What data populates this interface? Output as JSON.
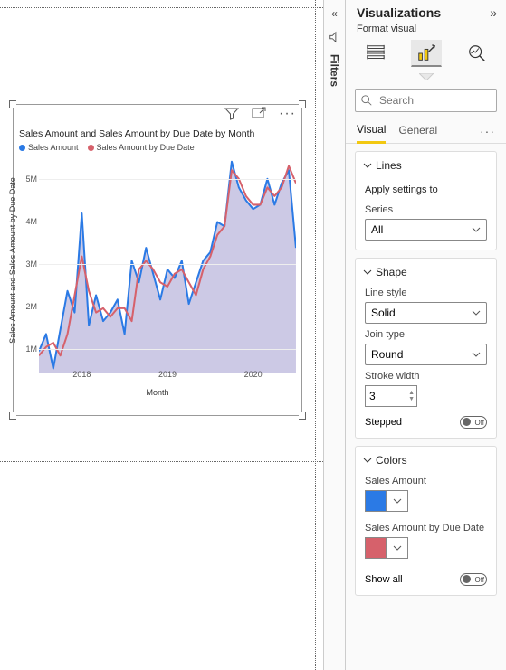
{
  "rail": {
    "filters_label": "Filters"
  },
  "pane": {
    "title": "Visualizations",
    "subtitle": "Format visual",
    "search_placeholder": "Search",
    "tabs": {
      "visual": "Visual",
      "general": "General"
    },
    "lines": {
      "header": "Lines",
      "apply": "Apply settings to",
      "series_label": "Series",
      "series_value": "All"
    },
    "shape": {
      "header": "Shape",
      "line_style_label": "Line style",
      "line_style_value": "Solid",
      "join_label": "Join type",
      "join_value": "Round",
      "stroke_label": "Stroke width",
      "stroke_value": "3",
      "stepped_label": "Stepped",
      "stepped_state": "Off"
    },
    "colors": {
      "header": "Colors",
      "series1_label": "Sales Amount",
      "series1_hex": "#2b7ae5",
      "series2_label": "Sales Amount by Due Date",
      "series2_hex": "#d6616b",
      "showall_label": "Show all",
      "showall_state": "Off"
    }
  },
  "chart_data": {
    "type": "line",
    "title": "Sales Amount and Sales Amount by Due Date by Month",
    "xlabel": "Month",
    "ylabel": "Sales Amount and Sales Amount by Due Date",
    "ylim": [
      500000,
      5500000
    ],
    "yticks": [
      "1M",
      "2M",
      "3M",
      "4M",
      "5M"
    ],
    "xticks": [
      "2018",
      "2019",
      "2020"
    ],
    "x": [
      0,
      1,
      2,
      3,
      4,
      5,
      6,
      7,
      8,
      9,
      10,
      11,
      12,
      13,
      14,
      15,
      16,
      17,
      18,
      19,
      20,
      21,
      22,
      23,
      24,
      25,
      26,
      27,
      28,
      29,
      30,
      31,
      32,
      33,
      34,
      35,
      36
    ],
    "series": [
      {
        "name": "Sales Amount",
        "color": "#2b7ae5",
        "values": [
          1000000,
          1400000,
          600000,
          1500000,
          2400000,
          1900000,
          4200000,
          1600000,
          2300000,
          1700000,
          1900000,
          2200000,
          1400000,
          3100000,
          2600000,
          3400000,
          2800000,
          2200000,
          2900000,
          2700000,
          3100000,
          2100000,
          2600000,
          3100000,
          3300000,
          4000000,
          3900000,
          5400000,
          4800000,
          4500000,
          4300000,
          4400000,
          5000000,
          4400000,
          4900000,
          5200000,
          3400000
        ]
      },
      {
        "name": "Sales Amount by Due Date",
        "color": "#d6616b",
        "values": [
          900000,
          1100000,
          1200000,
          900000,
          1400000,
          2300000,
          3200000,
          2400000,
          1900000,
          2000000,
          1800000,
          2000000,
          2000000,
          1700000,
          2900000,
          3100000,
          2900000,
          2600000,
          2500000,
          2800000,
          2900000,
          2600000,
          2300000,
          2900000,
          3200000,
          3700000,
          3900000,
          5200000,
          5000000,
          4600000,
          4400000,
          4400000,
          4800000,
          4600000,
          4800000,
          5300000,
          4900000
        ]
      }
    ]
  }
}
